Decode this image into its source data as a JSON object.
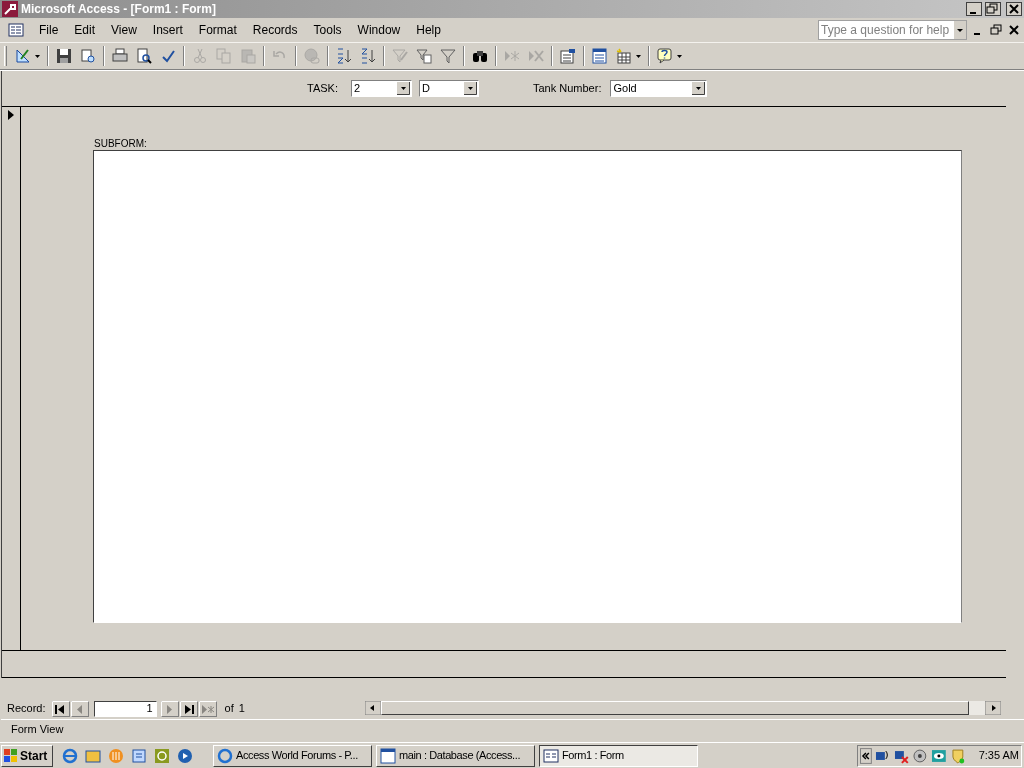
{
  "window": {
    "title": "Microsoft Access - [Form1 : Form]"
  },
  "menu": [
    "File",
    "Edit",
    "View",
    "Insert",
    "Format",
    "Records",
    "Tools",
    "Window",
    "Help"
  ],
  "help_box": {
    "placeholder": "Type a question for help"
  },
  "toolbar": [
    {
      "kind": "design",
      "disabled": false
    },
    {
      "kind": "separator"
    },
    {
      "kind": "save",
      "disabled": false
    },
    {
      "kind": "search",
      "disabled": false
    },
    {
      "kind": "separator"
    },
    {
      "kind": "print",
      "disabled": false
    },
    {
      "kind": "preview",
      "disabled": false
    },
    {
      "kind": "spelling",
      "disabled": false
    },
    {
      "kind": "separator"
    },
    {
      "kind": "cut",
      "disabled": true
    },
    {
      "kind": "copy",
      "disabled": true
    },
    {
      "kind": "paste",
      "disabled": true
    },
    {
      "kind": "separator"
    },
    {
      "kind": "undo",
      "disabled": true
    },
    {
      "kind": "separator"
    },
    {
      "kind": "hyperlink",
      "disabled": true
    },
    {
      "kind": "separator"
    },
    {
      "kind": "sort_asc",
      "disabled": false
    },
    {
      "kind": "sort_desc",
      "disabled": false
    },
    {
      "kind": "separator"
    },
    {
      "kind": "filter_selection",
      "disabled": true
    },
    {
      "kind": "filter_form",
      "disabled": false
    },
    {
      "kind": "filter",
      "disabled": false
    },
    {
      "kind": "separator"
    },
    {
      "kind": "find",
      "disabled": false
    },
    {
      "kind": "separator"
    },
    {
      "kind": "new_record",
      "disabled": true
    },
    {
      "kind": "delete_record",
      "disabled": true
    },
    {
      "kind": "separator"
    },
    {
      "kind": "properties",
      "disabled": false
    },
    {
      "kind": "separator"
    },
    {
      "kind": "database",
      "disabled": false
    },
    {
      "kind": "new_object",
      "disabled": false
    },
    {
      "kind": "separator"
    },
    {
      "kind": "help",
      "disabled": false
    }
  ],
  "task": {
    "label": "TASK:",
    "value_1": "2",
    "value_2": "D"
  },
  "tank_number": {
    "label": "Tank Number:",
    "value": "Gold"
  },
  "subform": {
    "label": "SUBFORM:"
  },
  "navigation": {
    "label": "Record:",
    "current": "1",
    "of_label": "of",
    "total": "1",
    "buttons": [
      {
        "kind": "first",
        "disabled": false
      },
      {
        "kind": "previous",
        "disabled": true
      },
      {
        "kind": "field"
      },
      {
        "kind": "next",
        "disabled": true
      },
      {
        "kind": "last",
        "disabled": false
      },
      {
        "kind": "new",
        "disabled": true
      }
    ]
  },
  "status_bar": {
    "text": "Form View"
  },
  "taskbar": {
    "start": "Start",
    "buttons": [
      {
        "label": "Access World Forums - P...",
        "kind": "browser",
        "selected": false
      },
      {
        "label": "main : Database (Access...",
        "kind": "database",
        "selected": false
      },
      {
        "label": "Form1 : Form",
        "kind": "form",
        "selected": true
      }
    ],
    "clock": "7:35 AM"
  }
}
